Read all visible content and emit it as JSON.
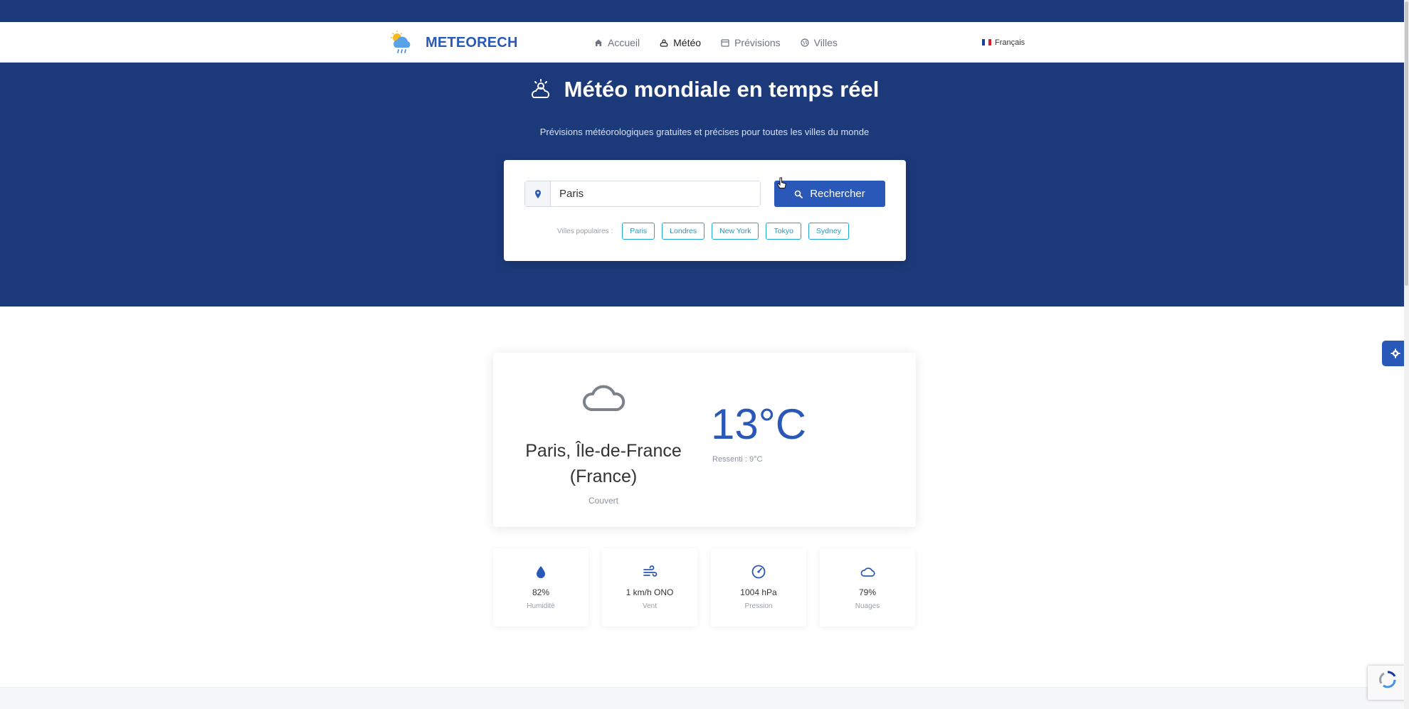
{
  "brand": {
    "name": "METEORECH"
  },
  "nav": {
    "items": [
      {
        "label": "Accueil",
        "icon": "home-icon",
        "active": false
      },
      {
        "label": "Météo",
        "icon": "weather-icon",
        "active": true
      },
      {
        "label": "Prévisions",
        "icon": "calendar-icon",
        "active": false
      },
      {
        "label": "Villes",
        "icon": "globe-icon",
        "active": false
      }
    ],
    "language": "Français"
  },
  "hero": {
    "title": "Météo mondiale en temps réel",
    "subtitle": "Prévisions météorologiques gratuites et précises pour toutes les villes du monde"
  },
  "search": {
    "value": "Paris",
    "button_label": "Rechercher",
    "popular_label": "Villes populaires :",
    "popular_cities": [
      "Paris",
      "Londres",
      "New York",
      "Tokyo",
      "Sydney"
    ]
  },
  "current": {
    "location": "Paris, Île-de-France (France)",
    "condition": "Couvert",
    "temperature": "13°C",
    "feels_like": "Ressenti : 9°C",
    "icon": "cloud-icon"
  },
  "stats": [
    {
      "value": "82%",
      "label": "Humidité",
      "icon": "drop-icon"
    },
    {
      "value": "1 km/h ONO",
      "label": "Vent",
      "icon": "wind-icon"
    },
    {
      "value": "1004 hPa",
      "label": "Pression",
      "icon": "gauge-icon"
    },
    {
      "value": "79%",
      "label": "Nuages",
      "icon": "cloud-icon"
    }
  ],
  "colors": {
    "primary": "#2a58b8",
    "header_bg": "#1c3a7a",
    "chip": "#1fa8d6"
  }
}
